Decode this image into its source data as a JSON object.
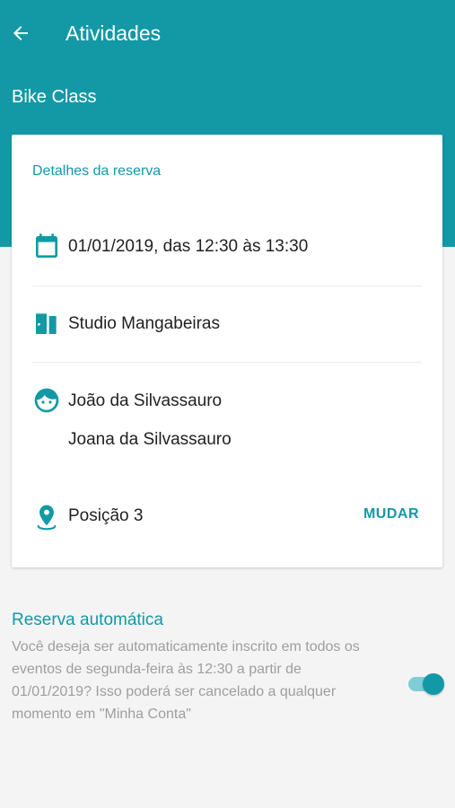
{
  "appbar": {
    "title": "Atividades",
    "back_icon": "arrow-left-icon"
  },
  "class_name": "Bike Class",
  "details": {
    "title": "Detalhes da reserva",
    "datetime": "01/01/2019, das 12:30 às 13:30",
    "location": "Studio Mangabeiras",
    "participants": [
      "João da Silvassauro",
      "Joana da Silvassauro"
    ],
    "position": "Posição 3",
    "change_label": "MUDAR",
    "icons": {
      "datetime": "calendar-icon",
      "location": "door-icon",
      "participants": "face-icon",
      "position": "map-pin-icon"
    }
  },
  "auto_booking": {
    "title": "Reserva automática",
    "description": "Você deseja ser automaticamente inscrito em todos os eventos de segunda-feira às 12:30 a partir de 01/01/2019? Isso poderá ser cancelado a qualquer momento em \"Minha Conta\"",
    "enabled": true
  },
  "colors": {
    "primary": "#1399a6",
    "toggle_track": "#7fcdd8",
    "background": "#f4f4f4",
    "text_primary": "#212121",
    "text_secondary": "#9e9e9e"
  }
}
